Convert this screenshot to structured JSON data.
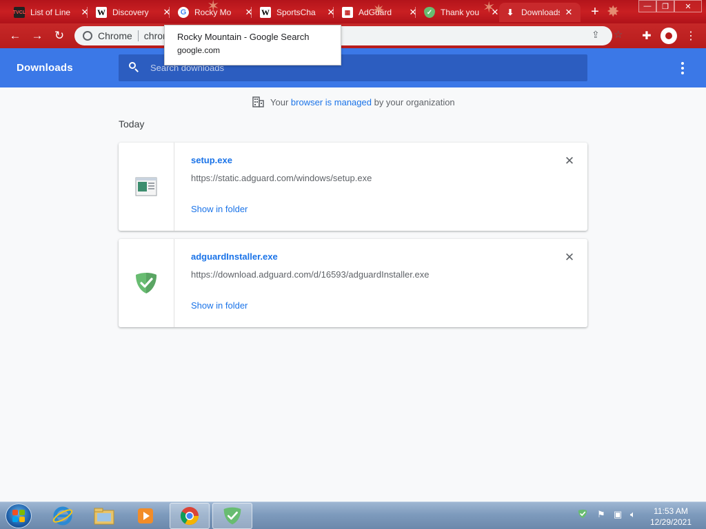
{
  "browser": {
    "tabs": [
      {
        "label": "List of Line",
        "favicon": "tvcl-logo-icon"
      },
      {
        "label": "Discovery",
        "favicon": "wikipedia-icon"
      },
      {
        "label": "Rocky Mo",
        "favicon": "google-icon"
      },
      {
        "label": "SportsCha",
        "favicon": "wikipedia-icon"
      },
      {
        "label": "AdGuard",
        "favicon": "adguard-calendar-icon"
      },
      {
        "label": "Thank you",
        "favicon": "adguard-shield-icon"
      },
      {
        "label": "Downloads",
        "favicon": "downloads-icon"
      }
    ],
    "omnibox": {
      "chip": "Chrome",
      "url": "chrome://downloads"
    },
    "tooltip": {
      "title": "Rocky Mountain - Google Search",
      "domain": "google.com"
    }
  },
  "downloads": {
    "title": "Downloads",
    "search_placeholder": "Search downloads",
    "managed_notice": {
      "prefix": "Your",
      "link": "browser is managed",
      "suffix": "by your organization"
    },
    "date_header": "Today",
    "items": [
      {
        "filename": "setup.exe",
        "url": "https://static.adguard.com/windows/setup.exe",
        "action": "Show in folder",
        "icon": "exe-file-icon"
      },
      {
        "filename": "adguardInstaller.exe",
        "url": "https://download.adguard.com/d/16593/adguardInstaller.exe",
        "action": "Show in folder",
        "icon": "adguard-shield-icon"
      }
    ]
  },
  "taskbar": {
    "clock_time": "11:53 AM",
    "clock_date": "12/29/2021"
  },
  "colors": {
    "theme_red": "#c62828",
    "downloads_header_blue": "#3b78e7",
    "link_blue": "#1a73e8",
    "adguard_green": "#68bc71"
  }
}
